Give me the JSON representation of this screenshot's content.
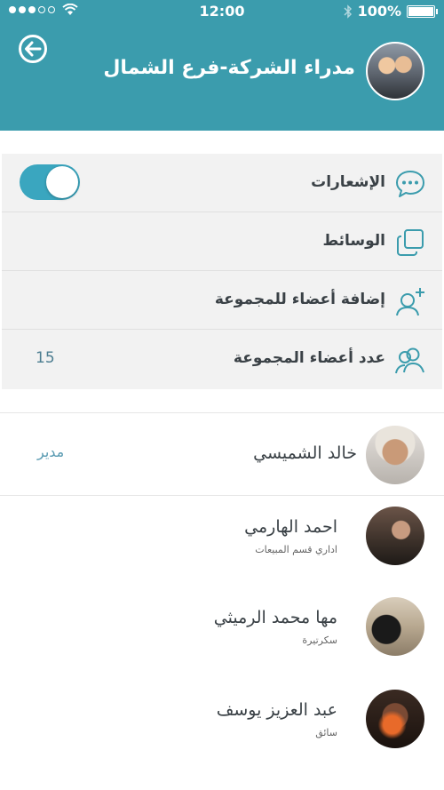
{
  "status_bar": {
    "time": "12:00",
    "battery": "100%"
  },
  "header": {
    "title": "مدراء الشركة-فرع الشمال",
    "back_icon": "back-arrow-icon",
    "avatar_icon": "group-avatar"
  },
  "settings": [
    {
      "label": "الإشعارات",
      "icon": "chat-bubble-icon",
      "toggle_on": true
    },
    {
      "label": "الوسائط",
      "icon": "media-copy-icon"
    },
    {
      "label": "إضافة أعضاء للمجموعة",
      "icon": "add-user-icon"
    },
    {
      "label": "عدد أعضاء المجموعة",
      "icon": "group-users-icon",
      "count": "15"
    }
  ],
  "members": [
    {
      "name": "خالد الشميسي",
      "role": "مدير"
    },
    {
      "name": "احمد الهارمي",
      "subtitle": "اداري قسم المبيعات"
    },
    {
      "name": "مها محمد الرميثي",
      "subtitle": "سكرتيرة"
    },
    {
      "name": "عبد العزيز يوسف",
      "subtitle": "سائق"
    }
  ],
  "colors": {
    "header": "#3b9cad",
    "accent": "#3aa6bf",
    "settings_bg": "#f2f2f2"
  }
}
